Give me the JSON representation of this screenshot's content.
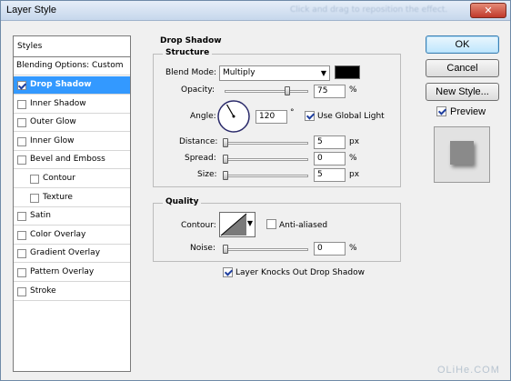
{
  "window": {
    "title": "Layer Style",
    "title_ghost": "Click and drag to reposition the effect.",
    "close_glyph": "✕"
  },
  "styles_list": {
    "header": "Styles",
    "blending_options": "Blending Options: Custom",
    "items": [
      {
        "label": "Drop Shadow",
        "checked": true,
        "selected": true
      },
      {
        "label": "Inner Shadow",
        "checked": false
      },
      {
        "label": "Outer Glow",
        "checked": false
      },
      {
        "label": "Inner Glow",
        "checked": false
      },
      {
        "label": "Bevel and Emboss",
        "checked": false
      },
      {
        "label": "Contour",
        "checked": false,
        "sub": true
      },
      {
        "label": "Texture",
        "checked": false,
        "sub": true
      },
      {
        "label": "Satin",
        "checked": false
      },
      {
        "label": "Color Overlay",
        "checked": false
      },
      {
        "label": "Gradient Overlay",
        "checked": false
      },
      {
        "label": "Pattern Overlay",
        "checked": false
      },
      {
        "label": "Stroke",
        "checked": false
      }
    ]
  },
  "panel": {
    "title": "Drop Shadow",
    "structure": {
      "label": "Structure",
      "blend_mode_label": "Blend Mode:",
      "blend_mode_value": "Multiply",
      "shadow_color": "#000000",
      "opacity_label": "Opacity:",
      "opacity_value": "75",
      "opacity_unit": "%",
      "opacity_fraction": 0.75,
      "angle_label": "Angle:",
      "angle_value": "120",
      "angle_unit": "°",
      "use_global_light_label": "Use Global Light",
      "use_global_light": true,
      "distance_label": "Distance:",
      "distance_value": "5",
      "distance_unit": "px",
      "spread_label": "Spread:",
      "spread_value": "0",
      "spread_unit": "%",
      "size_label": "Size:",
      "size_value": "5",
      "size_unit": "px"
    },
    "quality": {
      "label": "Quality",
      "contour_label": "Contour:",
      "anti_aliased_label": "Anti-aliased",
      "anti_aliased": false,
      "noise_label": "Noise:",
      "noise_value": "0",
      "noise_unit": "%"
    },
    "knockout_label": "Layer Knocks Out Drop Shadow",
    "knockout": true
  },
  "buttons": {
    "ok": "OK",
    "cancel": "Cancel",
    "new_style": "New Style...",
    "preview": "Preview",
    "preview_checked": true
  },
  "watermark": "OLiHe.COM"
}
